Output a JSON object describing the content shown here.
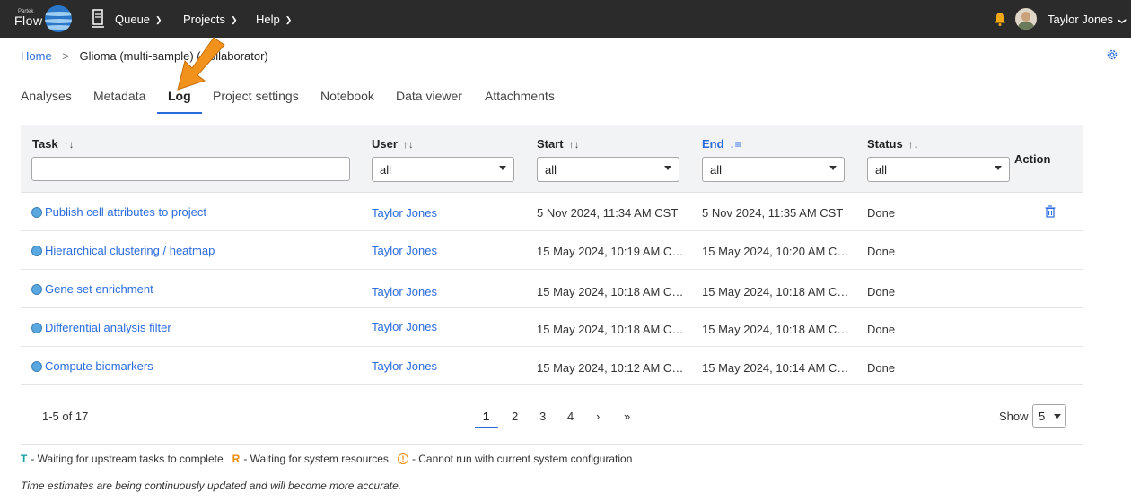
{
  "topbar": {
    "logo_small": "Partek",
    "logo": "Flow",
    "nav": [
      {
        "label": "Queue"
      },
      {
        "label": "Projects"
      },
      {
        "label": "Help"
      }
    ],
    "user_name": "Taylor Jones"
  },
  "breadcrumb": {
    "home": "Home",
    "separator": ">",
    "current": "Glioma (multi-sample) (Collaborator)"
  },
  "tabs": [
    {
      "label": "Analyses"
    },
    {
      "label": "Metadata"
    },
    {
      "label": "Log",
      "active": true
    },
    {
      "label": "Project settings"
    },
    {
      "label": "Notebook"
    },
    {
      "label": "Data viewer"
    },
    {
      "label": "Attachments"
    }
  ],
  "table": {
    "columns": {
      "task": "Task",
      "user": "User",
      "start": "Start",
      "end": "End",
      "status": "Status",
      "action": "Action"
    },
    "filters": {
      "task_value": "",
      "user": "all",
      "start": "all",
      "end": "all",
      "status": "all"
    },
    "rows": [
      {
        "task": "Publish cell attributes to project",
        "user": "Taylor Jones",
        "start": "5 Nov 2024, 11:34 AM CST",
        "end": "5 Nov 2024, 11:35 AM CST",
        "status": "Done"
      },
      {
        "task": "Hierarchical clustering / heatmap",
        "user": "Taylor Jones",
        "start": "15 May 2024, 10:19 AM C…",
        "end": "15 May 2024, 10:20 AM C…",
        "status": "Done"
      },
      {
        "task": "Gene set enrichment",
        "user": "Taylor Jones",
        "start": "15 May 2024, 10:18 AM C…",
        "end": "15 May 2024, 10:18 AM C…",
        "status": "Done"
      },
      {
        "task": "Differential analysis filter",
        "user": "Taylor Jones",
        "start": "15 May 2024, 10:18 AM C…",
        "end": "15 May 2024, 10:18 AM C…",
        "status": "Done"
      },
      {
        "task": "Compute biomarkers",
        "user": "Taylor Jones",
        "start": "15 May 2024, 10:12 AM C…",
        "end": "15 May 2024, 10:14 AM C…",
        "status": "Done"
      }
    ]
  },
  "pagination": {
    "range": "1-5 of 17",
    "pages": [
      "1",
      "2",
      "3",
      "4"
    ],
    "next": "›",
    "last": "»",
    "show_label": "Show",
    "show_value": "5"
  },
  "legend": {
    "t_letter": "T",
    "t_text": "- Waiting for upstream tasks to complete",
    "r_letter": "R",
    "r_text": "- Waiting for system resources",
    "warn_glyph": "!",
    "warn_text": "- Cannot run with current system configuration"
  },
  "note": "Time estimates are being continuously updated and will become more accurate.",
  "colors": {
    "topbar": "#2b2b2b",
    "accent": "#2b6cdd",
    "annotation_arrow": "#f0921c",
    "header_bg": "#f2f3f5"
  }
}
